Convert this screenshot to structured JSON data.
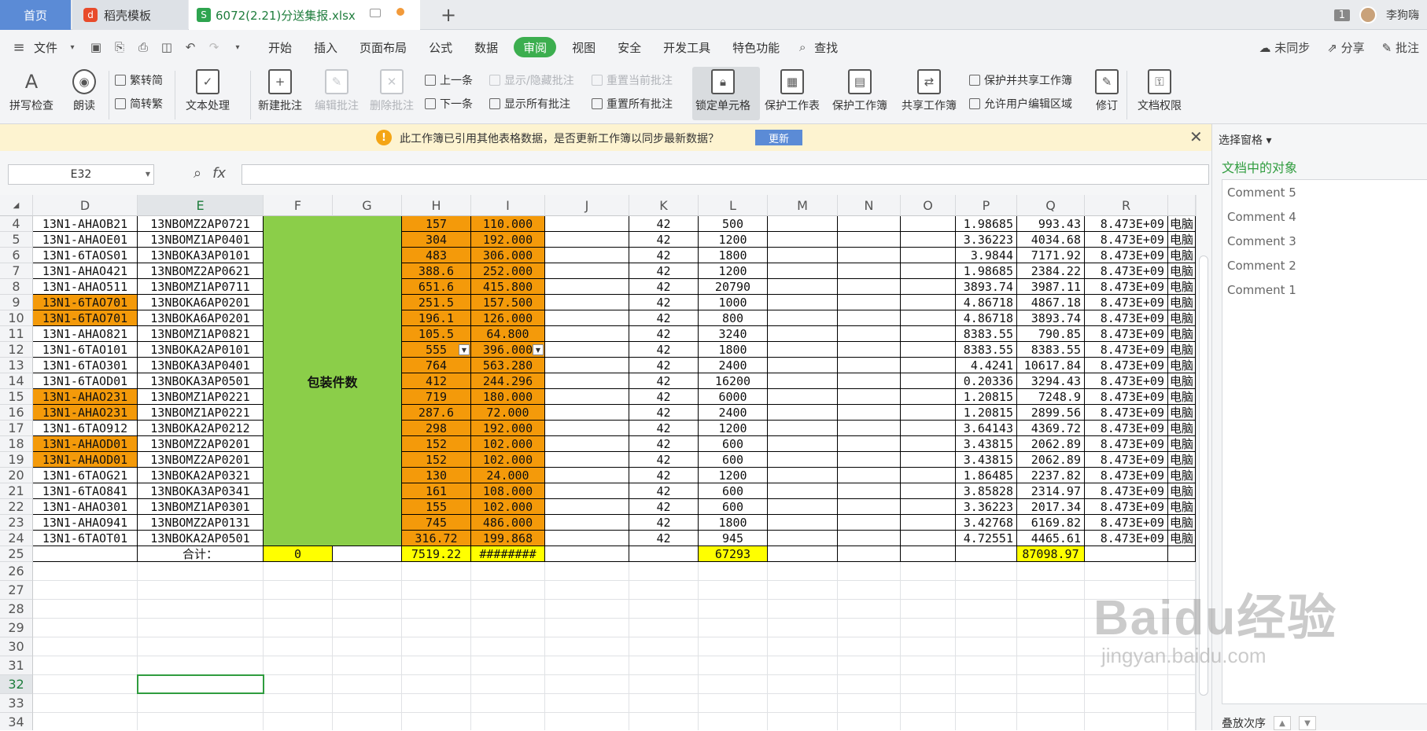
{
  "tabs": {
    "home": "首页",
    "template": "稻壳模板",
    "file": "6072(2.21)分送集报.xlsx",
    "count": "1",
    "user": "李狗嗨"
  },
  "menu": {
    "file": "文件",
    "items": [
      "开始",
      "插入",
      "页面布局",
      "公式",
      "数据",
      "审阅",
      "视图",
      "安全",
      "开发工具",
      "特色功能"
    ],
    "search": "查找",
    "right": [
      "未同步",
      "分享",
      "批注"
    ]
  },
  "ribbon": {
    "spell": "拼写检查",
    "read": "朗读",
    "trad": "繁转简",
    "simp": "简转繁",
    "text": "文本处理",
    "new_comment": "新建批注",
    "edit_comment": "编辑批注",
    "del_comment": "删除批注",
    "prev": "上一条",
    "next": "下一条",
    "show_hide": "显示/隐藏批注",
    "show_all": "显示所有批注",
    "reset_cur": "重置当前批注",
    "reset_all": "重置所有批注",
    "lock_cell": "锁定单元格",
    "protect_sheet": "保护工作表",
    "protect_book": "保护工作簿",
    "share_book": "共享工作簿",
    "protect_share": "保护并共享工作簿",
    "allow_edit": "允许用户编辑区域",
    "revise": "修订",
    "doc_perm": "文档权限"
  },
  "notification": {
    "message": "此工作簿已引用其他表格数据，是否更新工作簿以同步最新数据？",
    "button": "更新"
  },
  "formula": {
    "namebox": "E32",
    "fx": "fx"
  },
  "columns": [
    "D",
    "E",
    "F",
    "G",
    "H",
    "I",
    "J",
    "K",
    "L",
    "M",
    "N",
    "O",
    "P",
    "Q",
    "R"
  ],
  "merged_label": "包装件数",
  "rows": [
    {
      "n": "4",
      "d": "13N1-AHAOB21",
      "e": "13NBOMZ2AP0721",
      "h": "157",
      "i": "110.000",
      "k": "42",
      "l": "500",
      "p": "1.98685",
      "q": "993.43",
      "r": "8.473E+09",
      "s": "电脑"
    },
    {
      "n": "5",
      "d": "13N1-AHAOE01",
      "e": "13NBOMZ1AP0401",
      "h": "304",
      "i": "192.000",
      "k": "42",
      "l": "1200",
      "p": "3.36223",
      "q": "4034.68",
      "r": "8.473E+09",
      "s": "电脑"
    },
    {
      "n": "6",
      "d": "13N1-6TAOS01",
      "e": "13NBOKA3AP0101",
      "h": "483",
      "i": "306.000",
      "k": "42",
      "l": "1800",
      "p": "3.9844",
      "q": "7171.92",
      "r": "8.473E+09",
      "s": "电脑"
    },
    {
      "n": "7",
      "d": "13N1-AHAO421",
      "e": "13NBOMZ2AP0621",
      "h": "388.6",
      "i": "252.000",
      "k": "42",
      "l": "1200",
      "p": "1.98685",
      "q": "2384.22",
      "r": "8.473E+09",
      "s": "电脑"
    },
    {
      "n": "8",
      "d": "13N1-AHAO511",
      "e": "13NBOMZ1AP0711",
      "h": "651.6",
      "i": "415.800",
      "k": "42",
      "l": "20790",
      "p": "3893.74",
      "q": "3987.11",
      "r": "8.473E+09",
      "s": "电脑"
    },
    {
      "n": "9",
      "d": "13N1-6TAO701",
      "e": "13NBOKA6AP0201",
      "h": "251.5",
      "i": "157.500",
      "k": "42",
      "l": "1000",
      "p": "4.86718",
      "q": "4867.18",
      "r": "8.473E+09",
      "s": "电脑",
      "dor": true
    },
    {
      "n": "10",
      "d": "13N1-6TAO701",
      "e": "13NBOKA6AP0201",
      "h": "196.1",
      "i": "126.000",
      "k": "42",
      "l": "800",
      "p": "4.86718",
      "q": "3893.74",
      "r": "8.473E+09",
      "s": "电脑",
      "dor": true
    },
    {
      "n": "11",
      "d": "13N1-AHAO821",
      "e": "13NBOMZ1AP0821",
      "h": "105.5",
      "i": "64.800",
      "k": "42",
      "l": "3240",
      "p": "8383.55",
      "q": "790.85",
      "r": "8.473E+09",
      "s": "电脑"
    },
    {
      "n": "12",
      "d": "13N1-6TAO101",
      "e": "13NBOKA2AP0101",
      "h": "555",
      "i": "396.000",
      "k": "42",
      "l": "1800",
      "p": "8383.55",
      "q": "8383.55",
      "r": "8.473E+09",
      "s": "电脑",
      "dd": true
    },
    {
      "n": "13",
      "d": "13N1-6TAO301",
      "e": "13NBOKA3AP0401",
      "h": "764",
      "i": "563.280",
      "k": "42",
      "l": "2400",
      "p": "4.4241",
      "q": "10617.84",
      "r": "8.473E+09",
      "s": "电脑"
    },
    {
      "n": "14",
      "d": "13N1-6TAOD01",
      "e": "13NBOKA3AP0501",
      "h": "412",
      "i": "244.296",
      "k": "42",
      "l": "16200",
      "p": "0.20336",
      "q": "3294.43",
      "r": "8.473E+09",
      "s": "电脑"
    },
    {
      "n": "15",
      "d": "13N1-AHAO231",
      "e": "13NBOMZ1AP0221",
      "h": "719",
      "i": "180.000",
      "k": "42",
      "l": "6000",
      "p": "1.20815",
      "q": "7248.9",
      "r": "8.473E+09",
      "s": "电脑",
      "dor": true
    },
    {
      "n": "16",
      "d": "13N1-AHAO231",
      "e": "13NBOMZ1AP0221",
      "h": "287.6",
      "i": "72.000",
      "k": "42",
      "l": "2400",
      "p": "1.20815",
      "q": "2899.56",
      "r": "8.473E+09",
      "s": "电脑",
      "dor": true
    },
    {
      "n": "17",
      "d": "13N1-6TAO912",
      "e": "13NBOKA2AP0212",
      "h": "298",
      "i": "192.000",
      "k": "42",
      "l": "1200",
      "p": "3.64143",
      "q": "4369.72",
      "r": "8.473E+09",
      "s": "电脑"
    },
    {
      "n": "18",
      "d": "13N1-AHAOD01",
      "e": "13NBOMZ2AP0201",
      "h": "152",
      "i": "102.000",
      "k": "42",
      "l": "600",
      "p": "3.43815",
      "q": "2062.89",
      "r": "8.473E+09",
      "s": "电脑",
      "dor": true
    },
    {
      "n": "19",
      "d": "13N1-AHAOD01",
      "e": "13NBOMZ2AP0201",
      "h": "152",
      "i": "102.000",
      "k": "42",
      "l": "600",
      "p": "3.43815",
      "q": "2062.89",
      "r": "8.473E+09",
      "s": "电脑",
      "dor": true
    },
    {
      "n": "20",
      "d": "13N1-6TAOG21",
      "e": "13NBOKA2AP0321",
      "h": "130",
      "i": "24.000",
      "k": "42",
      "l": "1200",
      "p": "1.86485",
      "q": "2237.82",
      "r": "8.473E+09",
      "s": "电脑"
    },
    {
      "n": "21",
      "d": "13N1-6TAO841",
      "e": "13NBOKA3AP0341",
      "h": "161",
      "i": "108.000",
      "k": "42",
      "l": "600",
      "p": "3.85828",
      "q": "2314.97",
      "r": "8.473E+09",
      "s": "电脑"
    },
    {
      "n": "22",
      "d": "13N1-AHAO301",
      "e": "13NBOMZ1AP0301",
      "h": "155",
      "i": "102.000",
      "k": "42",
      "l": "600",
      "p": "3.36223",
      "q": "2017.34",
      "r": "8.473E+09",
      "s": "电脑"
    },
    {
      "n": "23",
      "d": "13N1-AHAO941",
      "e": "13NBOMZ2AP0131",
      "h": "745",
      "i": "486.000",
      "k": "42",
      "l": "1800",
      "p": "3.42768",
      "q": "6169.82",
      "r": "8.473E+09",
      "s": "电脑"
    },
    {
      "n": "24",
      "d": "13N1-6TAOT01",
      "e": "13NBOKA2AP0501",
      "h": "316.72",
      "i": "199.868",
      "k": "42",
      "l": "945",
      "p": "4.72551",
      "q": "4465.61",
      "r": "8.473E+09",
      "s": "电脑"
    }
  ],
  "total_row": {
    "n": "25",
    "label": "合计：",
    "f": "0",
    "h": "7519.22",
    "i": "########",
    "l": "67293",
    "q": "87098.97"
  },
  "empty_rows": [
    "26",
    "27",
    "28",
    "29",
    "30",
    "31",
    "32",
    "33",
    "34"
  ],
  "right_pane": {
    "title": "选择窗格",
    "subtitle": "文档中的对象",
    "objects": [
      "Comment 5",
      "Comment 4",
      "Comment 3",
      "Comment 2",
      "Comment 1"
    ],
    "order": "叠放次序"
  },
  "watermark": {
    "logo": "Baidu经验",
    "url": "jingyan.baidu.com"
  },
  "colors": {
    "orange": "#f49a0a",
    "yellow": "#ffff00",
    "green": "#8bce49",
    "accent": "#3cae4f"
  }
}
